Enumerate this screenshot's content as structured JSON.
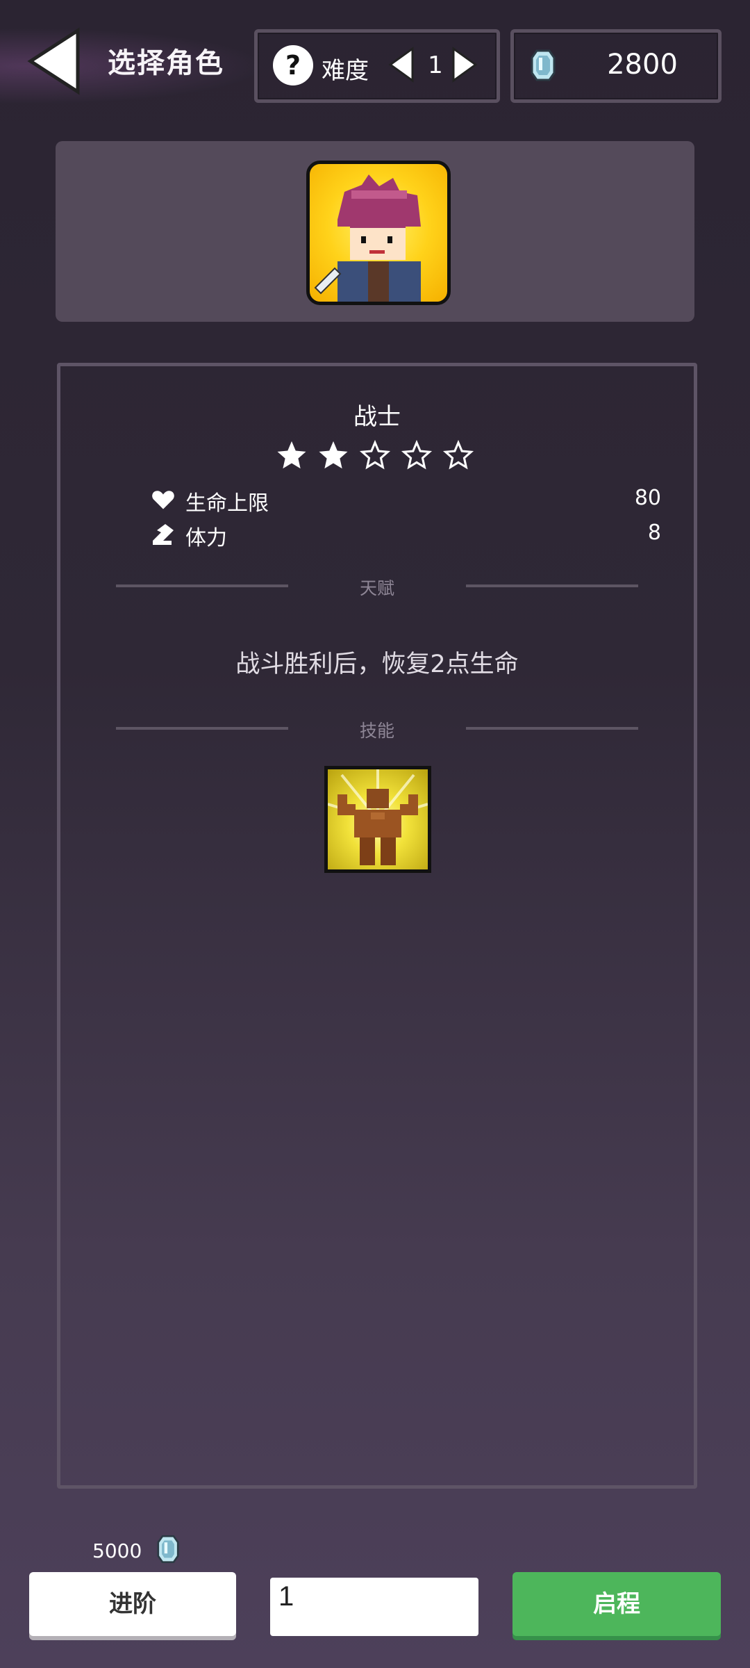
{
  "header": {
    "title": "选择角色",
    "difficulty_label": "难度",
    "difficulty_value": "1",
    "gems": "2800"
  },
  "character": {
    "name": "战士",
    "stars_filled": 2,
    "stars_total": 5,
    "stats": [
      {
        "icon": "heart-icon",
        "label": "生命上限",
        "value": "80"
      },
      {
        "icon": "boot-icon",
        "label": "体力",
        "value": "8"
      }
    ],
    "talent_heading": "天赋",
    "talent_text": "战斗胜利后，恢复2点生命",
    "skills_heading": "技能",
    "skills": [
      {
        "icon": "flexing-statue-skill-icon"
      }
    ]
  },
  "footer": {
    "advance_cost": "5000",
    "advance_label": "进阶",
    "quantity_value": "1",
    "start_label": "启程"
  },
  "colors": {
    "accent_green": "#4db65b",
    "portrait_yellow": "#ffd21a"
  }
}
